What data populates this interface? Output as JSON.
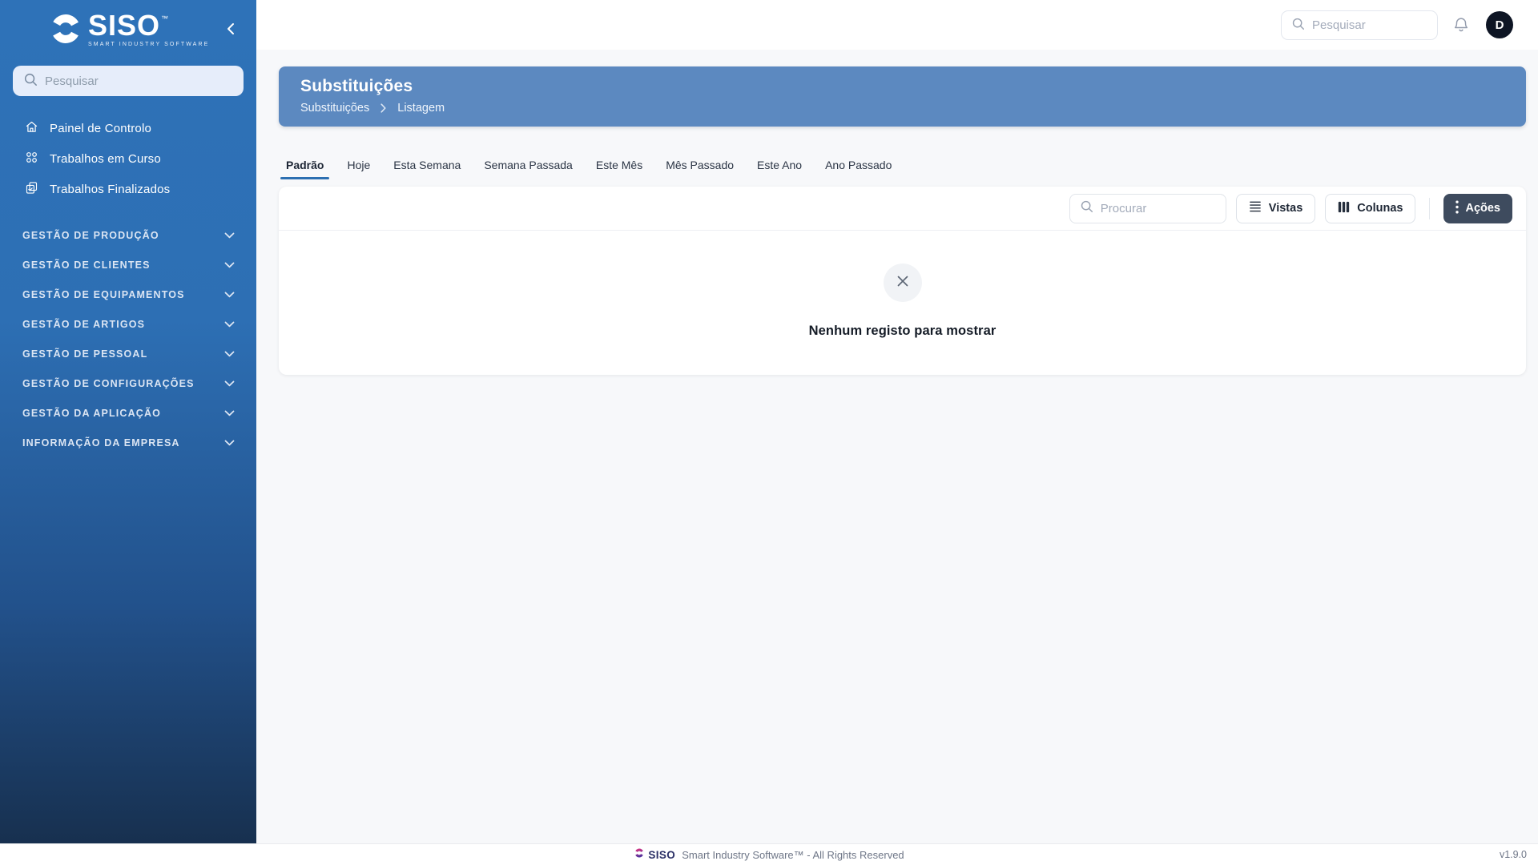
{
  "sidebar": {
    "logo": {
      "brand": "SISO",
      "tm": "™",
      "tagline": "SMART INDUSTRY SOFTWARE"
    },
    "search": {
      "placeholder": "Pesquisar"
    },
    "items": [
      {
        "label": "Painel de Controlo",
        "icon": "home-icon"
      },
      {
        "label": "Trabalhos em Curso",
        "icon": "grid-icon"
      },
      {
        "label": "Trabalhos Finalizados",
        "icon": "clipboard-check-icon"
      }
    ],
    "sections": [
      {
        "label": "GESTÃO DE PRODUÇÃO"
      },
      {
        "label": "GESTÃO DE CLIENTES"
      },
      {
        "label": "GESTÃO DE EQUIPAMENTOS"
      },
      {
        "label": "GESTÃO DE ARTIGOS"
      },
      {
        "label": "GESTÃO DE PESSOAL"
      },
      {
        "label": "GESTÃO DE CONFIGURAÇÕES"
      },
      {
        "label": "GESTÃO DA APLICAÇÃO"
      },
      {
        "label": "INFORMAÇÃO DA EMPRESA"
      }
    ]
  },
  "topbar": {
    "search": {
      "placeholder": "Pesquisar"
    },
    "avatar_initial": "D"
  },
  "page": {
    "title": "Substituições",
    "breadcrumb": {
      "root": "Substituições",
      "current": "Listagem"
    }
  },
  "tabs": [
    {
      "label": "Padrão"
    },
    {
      "label": "Hoje"
    },
    {
      "label": "Esta Semana"
    },
    {
      "label": "Semana Passada"
    },
    {
      "label": "Este Mês"
    },
    {
      "label": "Mês Passado"
    },
    {
      "label": "Este Ano"
    },
    {
      "label": "Ano Passado"
    }
  ],
  "active_tab": "Padrão",
  "toolbar": {
    "search": {
      "placeholder": "Procurar"
    },
    "views_label": "Vistas",
    "columns_label": "Colunas",
    "actions_label": "Ações"
  },
  "empty_state": {
    "message": "Nenhum registo para mostrar"
  },
  "footer": {
    "brand": "SISO",
    "text": "Smart Industry Software™ - All Rights Reserved",
    "version": "v1.9.0"
  },
  "colors": {
    "sidebar_top": "#2e72b8",
    "sidebar_bottom": "#17304f",
    "header_card": "#5c89c0",
    "accent": "#2c6fb1",
    "actions_button": "#3e4b5e",
    "avatar_bg": "#0e1524"
  }
}
